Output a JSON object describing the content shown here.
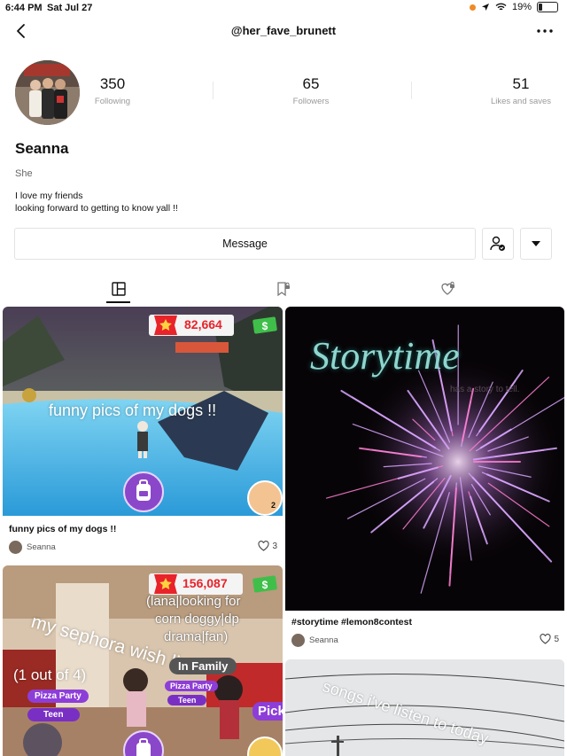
{
  "status": {
    "time": "6:44 PM",
    "date": "Sat Jul 27",
    "battery": "19%"
  },
  "header": {
    "username": "@her_fave_brunett"
  },
  "profile": {
    "name": "Seanna",
    "pronouns": "She",
    "bio_line1": "I love my friends",
    "bio_line2": "looking forward to getting to know yall !!",
    "stats": [
      {
        "value": "350",
        "label": "Following"
      },
      {
        "value": "65",
        "label": "Followers"
      },
      {
        "value": "51",
        "label": "Likes and saves"
      }
    ]
  },
  "actions": {
    "message_label": "Message"
  },
  "tabs": [
    {
      "icon": "grid-icon",
      "active": true
    },
    {
      "icon": "bookmark-lock-icon",
      "active": false
    },
    {
      "icon": "heart-lock-icon",
      "active": false
    }
  ],
  "posts": [
    {
      "caption": "funny pics of my dogs !!",
      "overlay_text": "funny pics of my dogs !!",
      "coins": "82,664",
      "count_badge": "2",
      "author": "Seanna",
      "likes": "3"
    },
    {
      "caption": "#storytime #lemon8contest",
      "overlay_title": "Storytime",
      "overlay_sub": "has a story to tell.",
      "author": "Seanna",
      "likes": "5"
    },
    {
      "overlay_title": "my sephora wish list",
      "overlay_sub": "(1 out of 4)",
      "coins": "156,087",
      "tag1": "(lana|looking for",
      "tag2": "corn doggy|dp",
      "tag3": "drama|fan)",
      "chip1": "In Family",
      "chip2": "Pizza Party",
      "chip3": "Teen",
      "chip4": "Pick"
    },
    {
      "overlay_title": "songs i've listen to today"
    }
  ],
  "colors": {
    "accent": "#111111",
    "muted": "#9a9a9a",
    "coin_red": "#e8232a"
  }
}
